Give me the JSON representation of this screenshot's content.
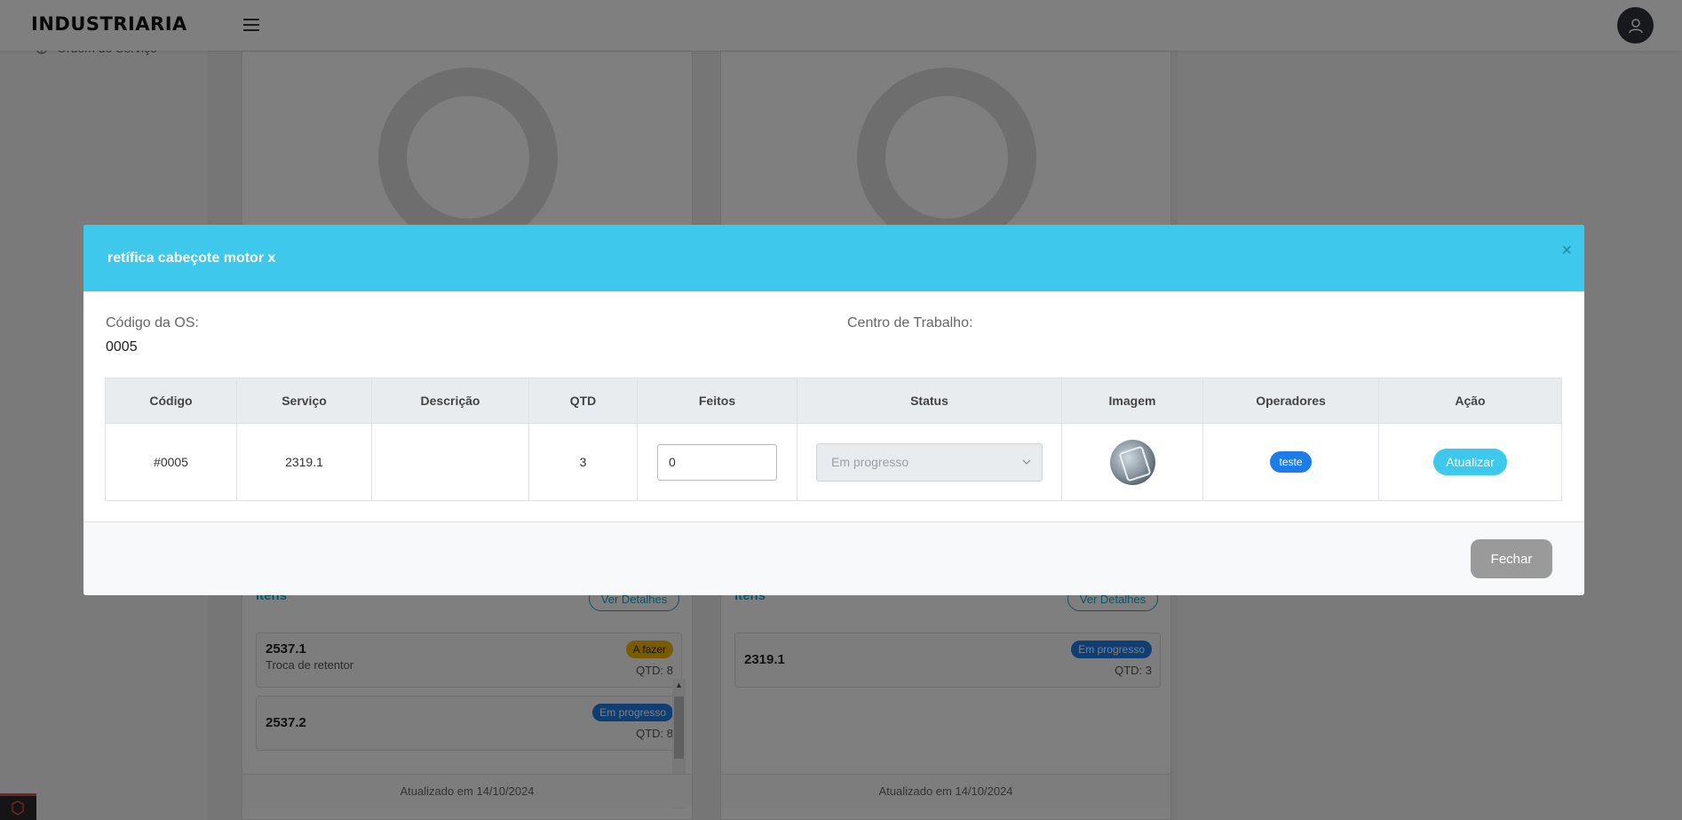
{
  "app": {
    "logo_text": "INDUSTRIARIA"
  },
  "sidebar": {
    "partial_item_label": "Ordem de Serviço"
  },
  "cards": [
    {
      "items_title": "Itens",
      "details_label": "Ver Detalhes",
      "items": [
        {
          "code": "2537.1",
          "description": "Troca de retentor",
          "status": "A fazer",
          "qtd": "QTD: 8"
        },
        {
          "code": "2537.2",
          "description": "",
          "status": "Em progresso",
          "qtd": "QTD: 8"
        }
      ],
      "footer": "Atualizado em 14/10/2024"
    },
    {
      "items_title": "Itens",
      "details_label": "Ver Detalhes",
      "items": [
        {
          "code": "2319.1",
          "description": "",
          "status": "Em progresso",
          "qtd": "QTD: 3"
        }
      ],
      "footer": "Atualizado em 14/10/2024"
    }
  ],
  "modal": {
    "title": "retífica cabeçote motor x",
    "close_glyph": "×",
    "os_code_label": "Código da OS:",
    "os_code_value": "0005",
    "work_center_label": "Centro de Trabalho:",
    "work_center_value": "",
    "table": {
      "headers": [
        "Código",
        "Serviço",
        "Descrição",
        "QTD",
        "Feitos",
        "Status",
        "Imagem",
        "Operadores",
        "Ação"
      ],
      "rows": [
        {
          "codigo": "#0005",
          "servico": "2319.1",
          "descricao": "",
          "qtd": "3",
          "feitos": "0",
          "status": "Em progresso",
          "operador": "teste",
          "acao": "Atualizar"
        }
      ]
    },
    "footer_button": "Fechar"
  },
  "colors": {
    "modal_header": "#3ec8ec",
    "badge_progress": "#1d7ce8",
    "badge_todo": "#f2b705",
    "close_button": "#9a9a9a"
  }
}
